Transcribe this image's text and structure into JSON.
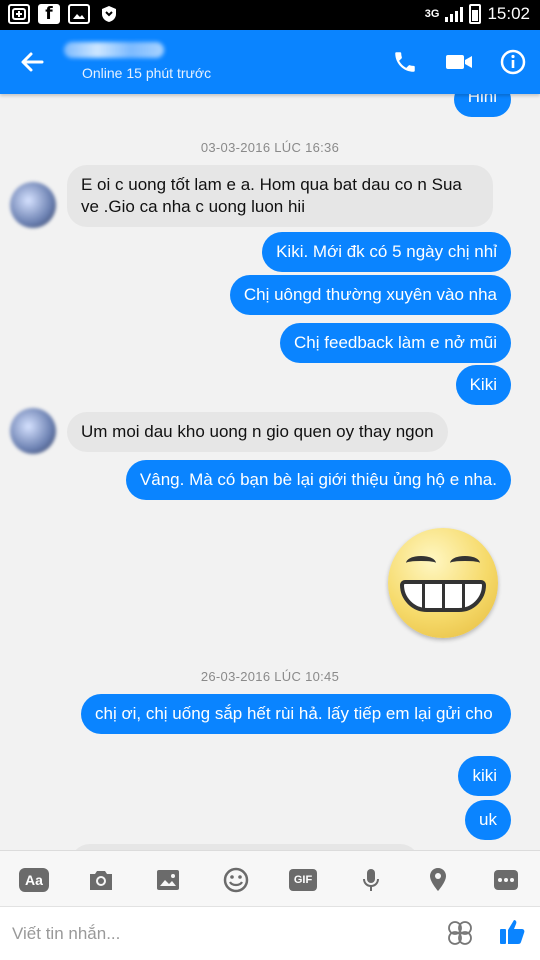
{
  "appbar": {
    "status": "Online 15 phút trước"
  },
  "conversation": {
    "partial_top": "Hihi",
    "timestamp_1": "03-03-2016 LÚC 16:36",
    "msg_in_1": "E oi c uong tốt lam e a. Hom qua bat dau co n Sua ve .Gio ca nha c uong luon hii",
    "msg_out_1": "Kiki. Mới đk có 5 ngày chị nhỉ",
    "msg_out_2": "Chị uôngd thường xuyên vào nha",
    "msg_out_3": "Chị feedback làm e nở mũi",
    "msg_out_4": "Kiki",
    "msg_in_2": "Um moi dau kho uong n gio quen oy thay ngon",
    "msg_out_5": "Vâng. Mà có bạn bè lại giới thiệu ủng hộ e nha.",
    "timestamp_2": "26-03-2016 LÚC 10:45",
    "msg_out_6": "chị ơi, chị uống sắp hết rùi hả. lấy tiếp em lại gửi cho",
    "msg_out_7": "kiki",
    "msg_out_8": "uk"
  },
  "toolbar": {
    "text_label": "Aa",
    "gif_label": "GIF"
  },
  "composer": {
    "placeholder": "Viết tin nhắn..."
  },
  "status_bar": {
    "network": "3G",
    "time": "15:02"
  },
  "colors": {
    "accent": "#0a84ff",
    "incoming_bubble": "#e6e6e6",
    "background": "#f2f2f2"
  },
  "icons": [
    "back-arrow-icon",
    "phone-icon",
    "video-icon",
    "info-icon",
    "camera-icon",
    "image-icon",
    "smiley-icon",
    "microphone-icon",
    "location-icon",
    "more-icon",
    "emoji-icon",
    "like-icon"
  ]
}
